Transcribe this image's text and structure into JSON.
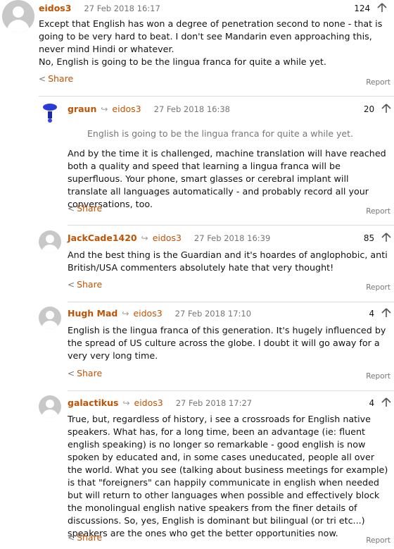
{
  "comments": [
    {
      "author": "eidos3",
      "date": "27 Feb 2018 16:17",
      "recommends": "124",
      "paragraphs": [
        "Except that English has won a degree of penetration second to none - that is going to be very hard to beat. I don't see Mandarin even approaching this, never mind Hindi or whatever.",
        "No, English is going to be the lingua franca for quite a while yet."
      ],
      "share": "Share",
      "report": "Report"
    },
    {
      "author": "graun",
      "reply_to": "eidos3",
      "date": "27 Feb 2018 16:38",
      "recommends": "20",
      "quote": "English is going to be the lingua franca for quite a while yet.",
      "paragraphs": [
        "And by the time it is challenged, machine translation will have reached both a quality and speed that learning a lingua franca will be superfluous. Your phone, smart glasses or cerebral implant will translate all languages automatically - and probably record all your conversations, too."
      ],
      "share": "Share",
      "report": "Report"
    },
    {
      "author": "JackCade1420",
      "reply_to": "eidos3",
      "date": "27 Feb 2018 16:39",
      "recommends": "85",
      "paragraphs": [
        "And the best thing is the Guardian and it's hoardes of anglophobic, anti British/USA commenters absolutely hate that very thought!"
      ],
      "share": "Share",
      "report": "Report"
    },
    {
      "author": "Hugh Mad",
      "reply_to": "eidos3",
      "date": "27 Feb 2018 17:10",
      "recommends": "4",
      "paragraphs": [
        "English is the lingua franca of this generation. It's hugely influenced by the spread of US culture across the globe. I doubt it will go away for a very very long time."
      ],
      "share": "Share",
      "report": "Report"
    },
    {
      "author": "galactikus",
      "reply_to": "eidos3",
      "date": "27 Feb 2018 17:27",
      "recommends": "4",
      "paragraphs": [
        "True, but, regardless of history, i see a crossroads for English native speakers. What has, for a long time, been an advantage (ie: fluent english speaking) is no longer so remarkable - good english is now spoken by educated and, in some cases uneducated, people all over the world. What you see (talking about business meetings for example) is that \"foreigners\" can happily communicate in english when needed but will return to other languages when possible and effectively block the monolingual english native speakers from the finer details of discussions. So, yes, English is dominant but bilingual (or tri etc...) speakers are the ones who get the better opportunities now."
      ],
      "share": "Share",
      "report": "Report"
    }
  ],
  "icons": {
    "reply": "reply-arrow-icon",
    "recommend": "recommend-up-arrow-icon",
    "share": "share-icon"
  },
  "colors": {
    "author": "#c05303",
    "meta": "#767676",
    "divider": "#dcdcdc"
  }
}
